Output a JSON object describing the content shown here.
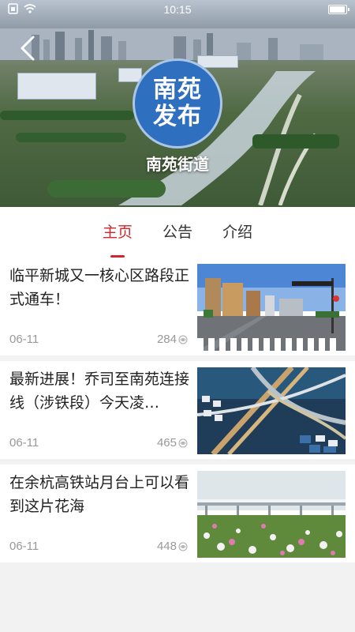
{
  "status_bar": {
    "time": "10:15"
  },
  "header": {
    "logo_line1": "南苑",
    "logo_line2": "发布",
    "street_name": "南苑街道"
  },
  "tabs": [
    {
      "label": "主页",
      "active": true
    },
    {
      "label": "公告",
      "active": false
    },
    {
      "label": "介绍",
      "active": false
    }
  ],
  "articles": [
    {
      "title": "临平新城又一核心区路段正式通车！",
      "date": "06-11",
      "views": "284",
      "thumb": "road-intersection-image"
    },
    {
      "title": "最新进展！乔司至南苑连接线（涉铁段）今天凌…",
      "date": "06-11",
      "views": "465",
      "thumb": "interchange-aerial-image"
    },
    {
      "title": "在余杭高铁站月台上可以看到这片花海",
      "date": "06-11",
      "views": "448",
      "thumb": "flower-field-railway-image"
    }
  ],
  "colors": {
    "accent": "#d0262d",
    "logo_blue": "#2f6fc0"
  }
}
